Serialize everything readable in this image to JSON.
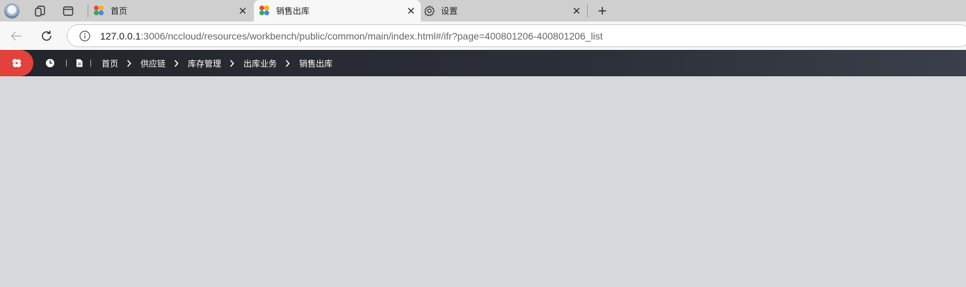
{
  "browser": {
    "tabs": [
      {
        "title": "首页",
        "icon": "app-colorful-icon",
        "active": false
      },
      {
        "title": "销售出库",
        "icon": "app-colorful-icon",
        "active": true
      },
      {
        "title": "设置",
        "icon": "gear-icon",
        "active": false
      }
    ],
    "close_glyph": "✕",
    "new_tab_glyph": "+"
  },
  "address": {
    "host": "127.0.0.1",
    "rest": ":3006/nccloud/resources/workbench/public/common/main/index.html#/ifr?page=400801206-400801206_list"
  },
  "app": {
    "breadcrumbs": [
      "首页",
      "供应链",
      "库存管理",
      "出库业务",
      "销售出库"
    ],
    "colors": {
      "logo": "#e2423b",
      "header": "#2b2f38",
      "content": "#d7d8da"
    }
  }
}
